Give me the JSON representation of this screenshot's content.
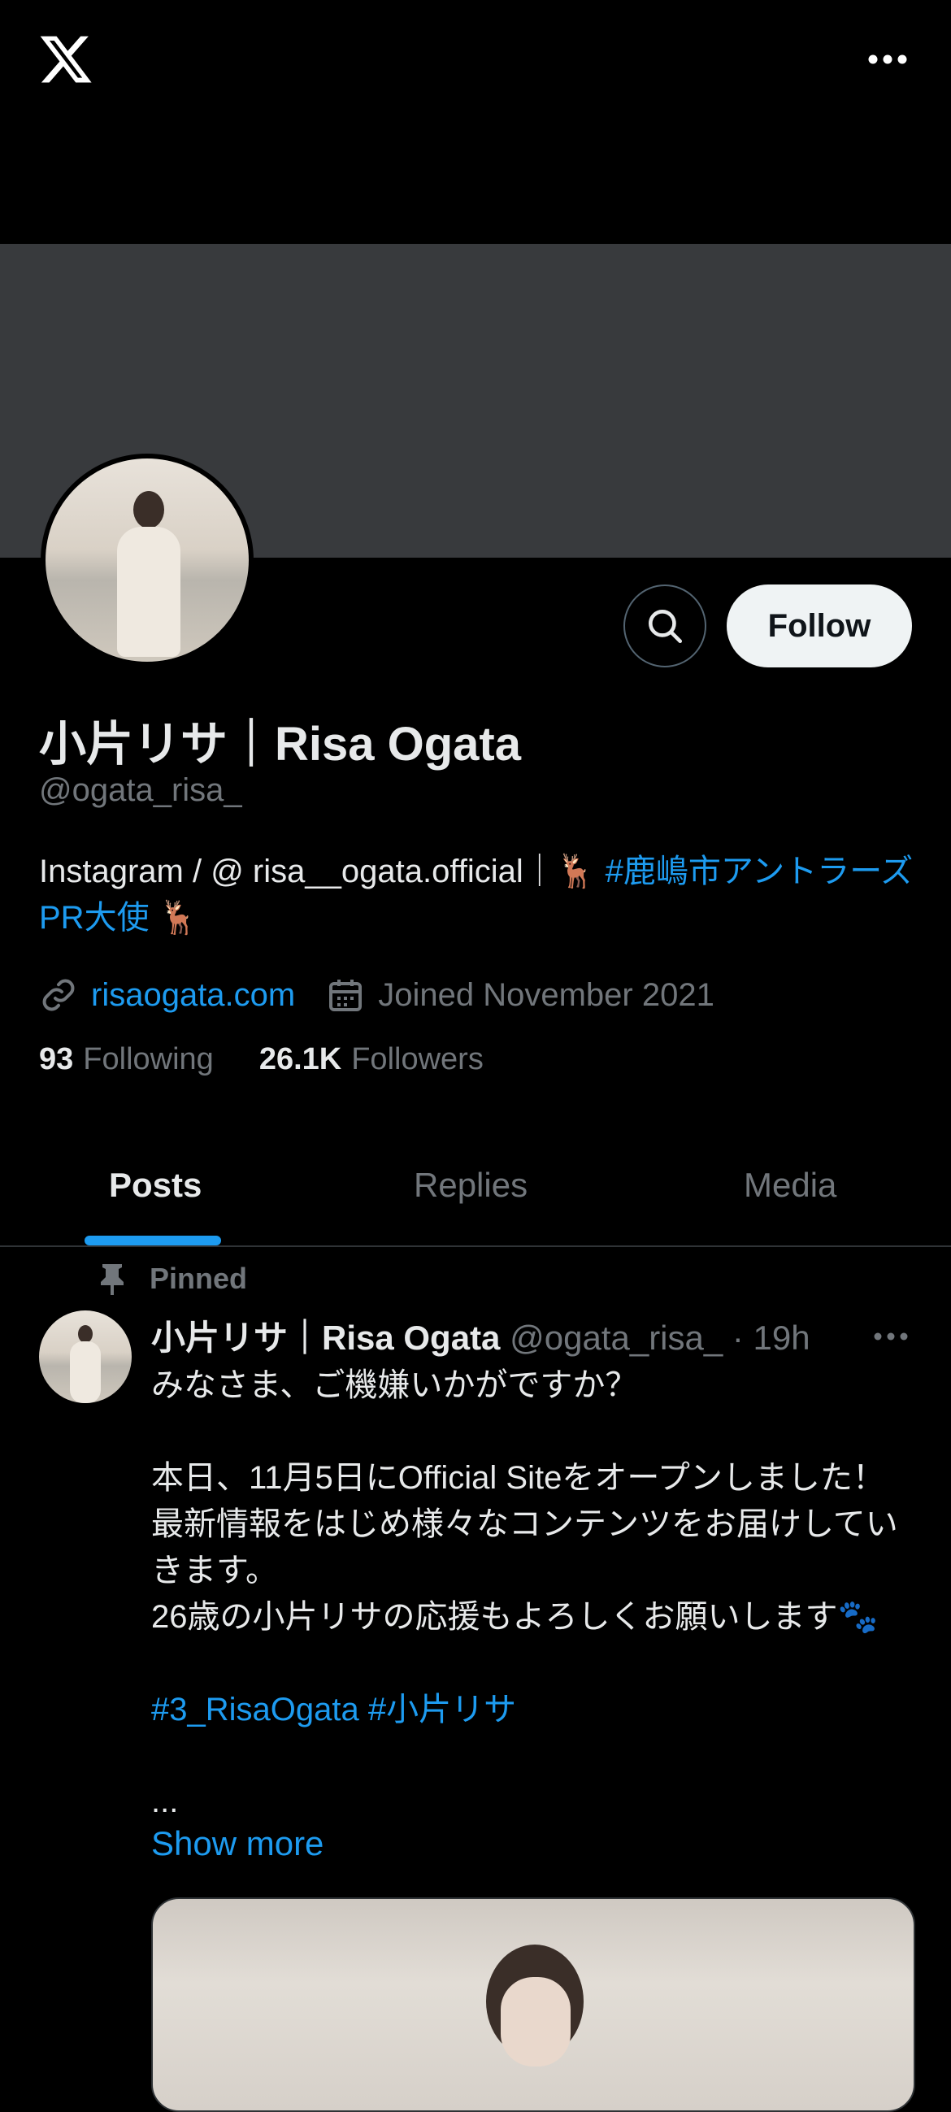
{
  "topbar": {
    "logo": "x-logo-icon",
    "more": "more-horizontal-icon"
  },
  "profile": {
    "name": "小片リサ｜Risa Ogata",
    "handle": "@ogata_risa_",
    "bio_text": "Instagram / @ risa__ogata.official｜🦌 ",
    "bio_hashtag": "#鹿嶋市アントラーズPR大使",
    "bio_suffix": " 🦌",
    "website": "risaogata.com",
    "joined": "Joined November 2021",
    "following_count": "93",
    "following_label": "Following",
    "followers_count": "26.1K",
    "followers_label": "Followers",
    "follow_label": "Follow"
  },
  "tabs": [
    {
      "label": "Posts",
      "active": true
    },
    {
      "label": "Replies",
      "active": false
    },
    {
      "label": "Media",
      "active": false
    }
  ],
  "post": {
    "pinned_label": "Pinned",
    "author_name": "小片リサ｜Risa Ogata",
    "author_handle_time": " @ogata_risa_ · 19h",
    "body": "みなさま、ご機嫌いかがですか？\n\n本日、11月5日にOfficial Siteをオープンしました！最新情報をはじめ様々なコンテンツをお届けしていきます。\n26歳の小片リサの応援もよろしくお願いします🐾",
    "hashtags": "#3_RisaOgata #小片リサ",
    "ellipsis": "...",
    "show_more": "Show more"
  },
  "colors": {
    "accent": "#1d9bf0",
    "background": "#000000",
    "banner": "#383a3d",
    "muted": "#71767b"
  }
}
